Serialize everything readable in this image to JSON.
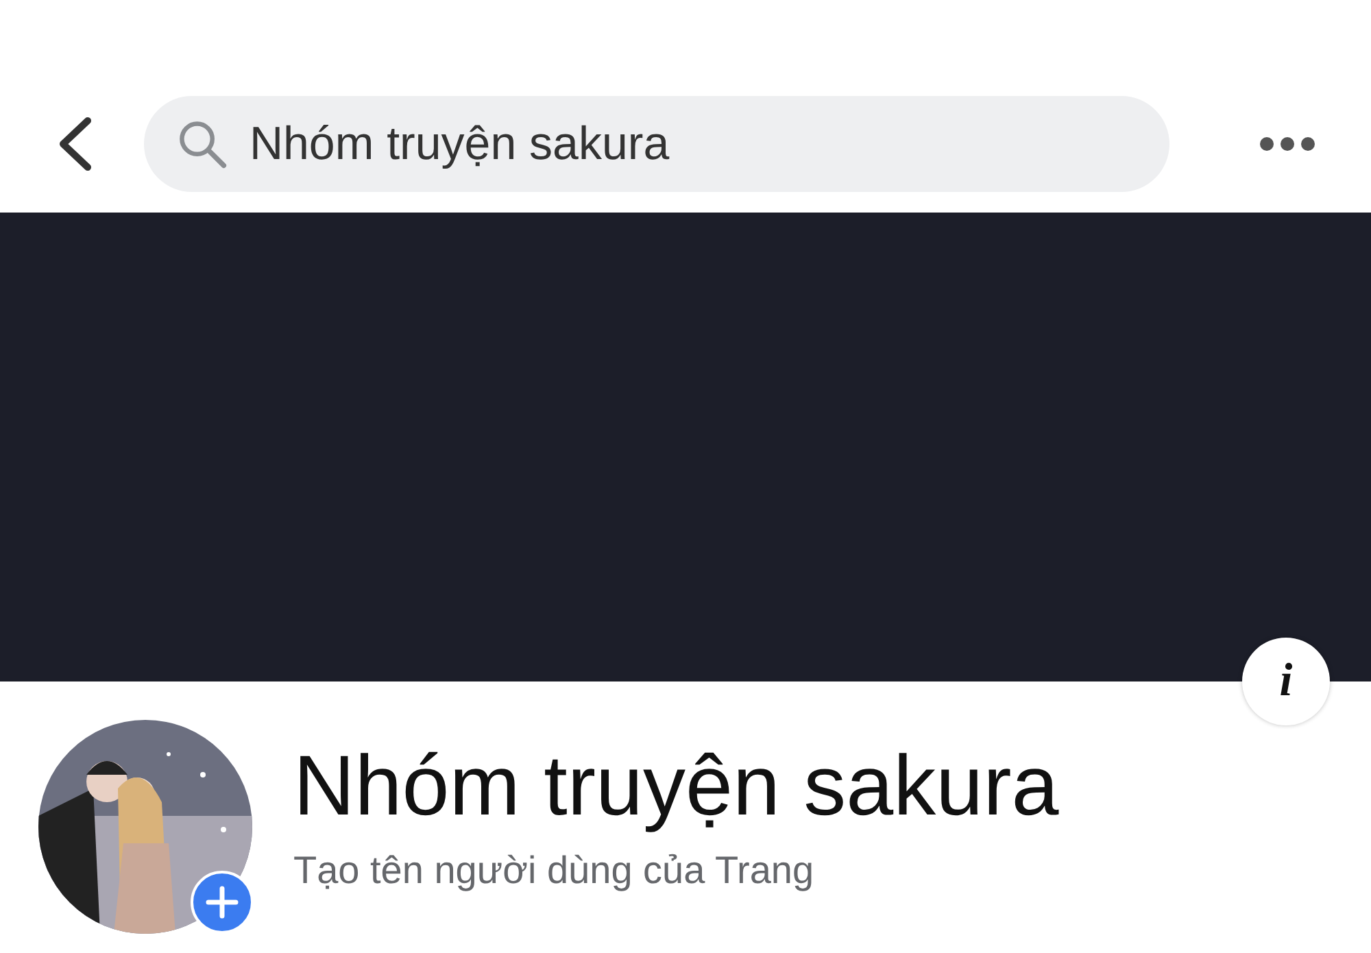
{
  "search": {
    "value": "Nhóm truyện sakura"
  },
  "info_button": {
    "label": "i"
  },
  "profile": {
    "name": "Nhóm truyện sakura",
    "subtitle": "Tạo tên người dùng của Trang"
  }
}
